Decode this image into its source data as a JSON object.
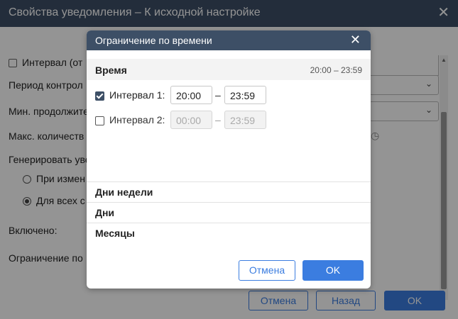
{
  "background": {
    "title": "Свойства уведомления – К исходной настройке",
    "rows": {
      "interval": "Интервал (от",
      "period": "Период контрол",
      "min_duration": "Мин. продолжите",
      "max_count": "Макс. количеств",
      "generate": "Генерировать уве",
      "on_change": "При измен",
      "for_all": "Для всех с",
      "enabled": "Включено:",
      "time_limit": "Ограничение по"
    },
    "buttons": {
      "cancel": "Отмена",
      "back": "Назад",
      "ok": "OK"
    }
  },
  "modal": {
    "title": "Ограничение по времени",
    "time_section": {
      "label": "Время",
      "range": "20:00 – 23:59"
    },
    "intervals": [
      {
        "label": "Интервал 1:",
        "start": "20:00",
        "end": "23:59",
        "checked": true,
        "enabled": true
      },
      {
        "label": "Интервал 2:",
        "start": "00:00",
        "end": "23:59",
        "checked": false,
        "enabled": false
      }
    ],
    "dash": "–",
    "sections": {
      "weekdays": "Дни недели",
      "days": "Дни",
      "months": "Месяцы"
    },
    "buttons": {
      "cancel": "Отмена",
      "ok": "OK"
    }
  },
  "colors": {
    "titlebar": "#3d4f66",
    "accent": "#3b7de0"
  },
  "icons": {
    "close": "close-icon",
    "checkbox_checked": "checkbox-checked-icon",
    "calendar": "calendar-icon"
  }
}
